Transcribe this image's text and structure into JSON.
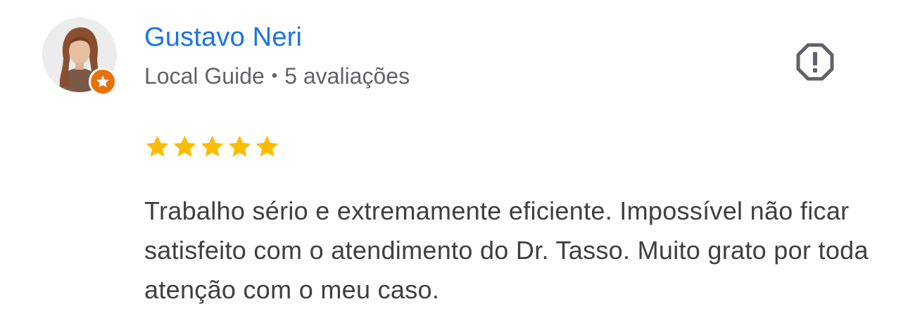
{
  "reviewer": {
    "name": "Gustavo Neri",
    "badge": "Local Guide",
    "separator": "•",
    "review_count": "5 avaliações"
  },
  "rating": {
    "stars": 5,
    "max": 5
  },
  "review": {
    "text": "Trabalho sério e extremamente eficiente. Impossível não ficar satisfeito com o atendimento do Dr. Tasso. Muito grato por toda atenção com o meu caso."
  },
  "icons": {
    "report": "report-flag-icon",
    "guide_badge": "local-guide-star-icon",
    "star": "star-icon"
  },
  "colors": {
    "name": "#1a73e8",
    "meta": "#5f6368",
    "text": "#3c4043",
    "star": "#fbbc04",
    "badge": "#e8710a",
    "report_icon": "#5f6368"
  }
}
